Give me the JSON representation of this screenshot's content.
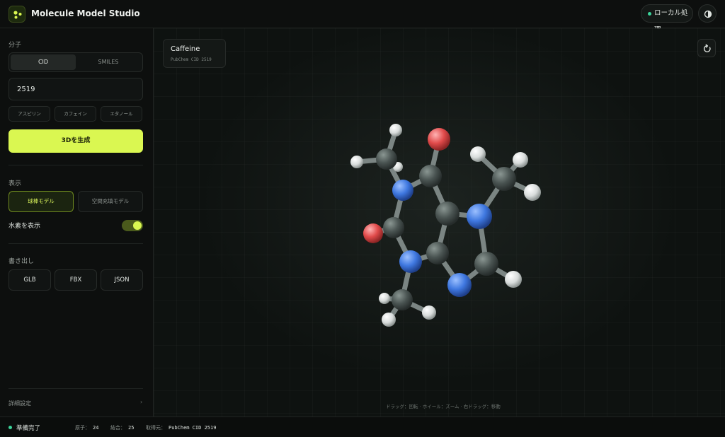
{
  "app": {
    "title": "Molecule Model Studio",
    "local_label": "ローカル処理",
    "accent_color": "#daf751",
    "status_color": "#3bd49a"
  },
  "sidebar": {
    "molecule_section": "分子",
    "input_modes": [
      "CID",
      "SMILES"
    ],
    "active_mode": "CID",
    "cid_value": "2519",
    "presets": [
      "アスピリン",
      "カフェイン",
      "エタノール"
    ],
    "generate_label": "3Dを生成",
    "display_section": "表示",
    "view_modes": [
      "球棒モデル",
      "空間充填モデル"
    ],
    "active_view": "球棒モデル",
    "hydrogen_label": "水素を表示",
    "hydrogen_on": true,
    "export_section": "書き出し",
    "export_formats": [
      "GLB",
      "FBX",
      "JSON"
    ],
    "advanced_label": "詳細設定",
    "advanced_chevron": "›"
  },
  "viewport": {
    "molecule_name": "Caffeine",
    "molecule_sub": "PubChem CID 2519",
    "hint": "ドラッグ：回転 · ホイール：ズーム · 右ドラッグ：移動"
  },
  "status": {
    "text": "準備完了",
    "atoms_label": "原子",
    "atoms_value": "24",
    "bonds_label": "結合",
    "bonds_value": "25",
    "source_label": "取得元",
    "source_value": "PubChem CID 2519"
  },
  "icons": {
    "logo": "molecule-logo-icon",
    "settings": "theme-icon",
    "reset": "reset-view-icon"
  }
}
